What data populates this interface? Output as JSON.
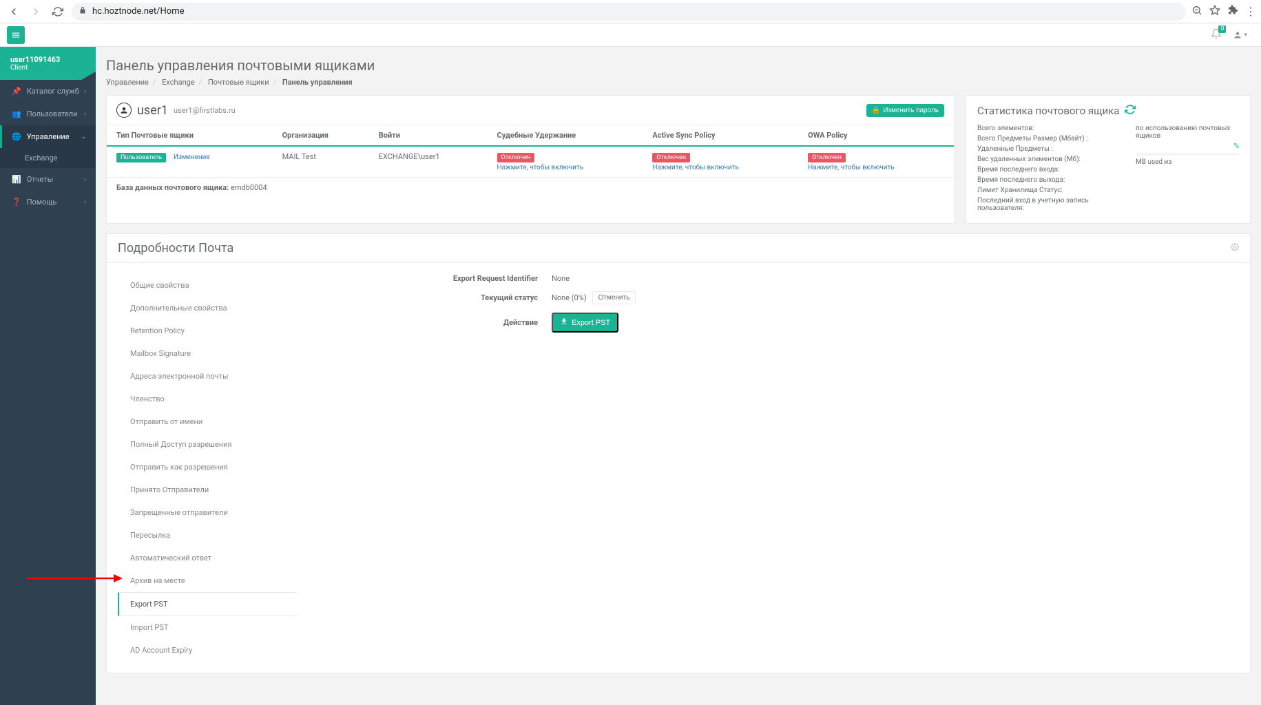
{
  "browser": {
    "url": "hc.hoztnode.net/Home"
  },
  "topbar": {
    "notif_count": "0"
  },
  "sidebar": {
    "user": "user11091463",
    "role": "Client",
    "items": [
      {
        "icon": "pin",
        "label": "Каталог служб"
      },
      {
        "icon": "users",
        "label": "Пользователи"
      },
      {
        "icon": "globe",
        "label": "Управление",
        "active": true,
        "sub": [
          {
            "label": "Exchange"
          }
        ]
      },
      {
        "icon": "chart",
        "label": "Отчеты"
      },
      {
        "icon": "help",
        "label": "Помощь"
      }
    ]
  },
  "page": {
    "title": "Панель управления почтовыми ящиками",
    "breadcrumb": [
      "Управление",
      "Exchange",
      "Почтовые ящики"
    ],
    "breadcrumb_current": "Панель управления"
  },
  "user_card": {
    "name": "user1",
    "email": "user1@firstlabs.ru",
    "change_pw": "Изменить пароль",
    "columns": [
      "Тип Почтовые ящики",
      "Организация",
      "Войти",
      "Судебные Удержание",
      "Active Sync Policy",
      "OWA Policy"
    ],
    "row": {
      "type_badge": "Пользователь",
      "type_change": "Изменение",
      "org": "MAIL Test",
      "login": "EXCHANGE\\user1",
      "litigation_badge": "Отключен",
      "litigation_link": "Нажмите, чтобы включить",
      "activesync_badge": "Отключен",
      "activesync_link": "Нажмите, чтобы включить",
      "owa_badge": "Отключен",
      "owa_link": "Нажмите, чтобы включить"
    },
    "db_label": "База данных почтового ящика:",
    "db_value": "emdb0004"
  },
  "stats": {
    "title": "Статистика почтового ящика",
    "left_rows": [
      "Всего элементов:",
      "Всего Предметы Размер (Мбайт) :",
      "Удаленные Предметы :",
      "Вес удаленных элементов (Мб):",
      "Время последнего входа:",
      "Время последнего выхода:",
      "Лимит Хранилища Статус:",
      "Последний вход в учетную запись пользователя:"
    ],
    "right_usage": "по использованию почтовых ящиков",
    "right_pct": "%",
    "right_mb": "MB used из"
  },
  "details": {
    "title": "Подробности Почта",
    "tabs": [
      "Общие свойства",
      "Дополнительные свойства",
      "Retention Policy",
      "Mailbox Signature",
      "Адреса электронной почты",
      "Членство",
      "Отправить от имени",
      "Полный Доступ разрешения",
      "Отправить как разрешения",
      "Принято Отправители",
      "Запрещенные отправители",
      "Пересылка",
      "Автоматический ответ",
      "Архив на месте",
      "Export PST",
      "Import PST",
      "AD Account Expiry"
    ],
    "active_tab": 14,
    "form": {
      "id_label": "Export Request Identifier",
      "id_value": "None",
      "status_label": "Текущий статус",
      "status_value": "None (0%)",
      "status_cancel": "Отменить",
      "action_label": "Действие",
      "action_btn": "Export PST"
    }
  }
}
